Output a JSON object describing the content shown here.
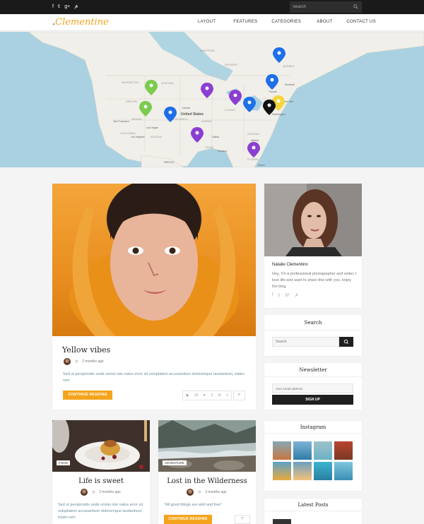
{
  "topbar": {
    "social_icons": [
      "facebook-icon",
      "twitter-icon",
      "google-plus-icon",
      "pinterest-icon"
    ],
    "social_glyphs": [
      "f",
      "𝕥",
      "g+",
      "𝓅"
    ],
    "search_placeholder": "Search"
  },
  "nav": {
    "logo": "Clementine",
    "logo_dot": ".",
    "items": [
      "LAYOUT",
      "FEATURES",
      "CATEGORIES",
      "ABOUT",
      "CONTACT US"
    ]
  },
  "map": {
    "labels": {
      "us": "United States",
      "mexico": "Mexico",
      "canada_region": "MANITOBA",
      "ontario": "ONTARIO",
      "washington": "WASHINGTON",
      "montana": "MONTANA",
      "oregon": "OREGON",
      "nevada": "NEVADA",
      "texas": "TEXAS",
      "ohio": "OHIO",
      "illinois": "ILLINOIS",
      "california": "CALIFORNIA",
      "florida": "FLORIDA",
      "arizona": "ARIZONA",
      "colorado": "COLORADO",
      "kansas": "KANSAS",
      "georgia": "GEORGIA",
      "chicago": "Chicago",
      "dallas": "Dallas",
      "las_vegas": "Las Vegas",
      "los_angeles": "Los Angeles",
      "san_francisco": "San Francisco",
      "houston": "Houston",
      "miami": "Miami",
      "denver": "Denver",
      "toronto": "Toronto",
      "montreal": "Montreal",
      "new_york": "New York",
      "washington_dc": "Washington",
      "atlanta": "Atlanta",
      "quebec": "QUEBEC"
    },
    "marker_colors": {
      "blue": "#1e6fe8",
      "purple": "#8b3fd1",
      "green": "#7ccb4f",
      "black": "#111111",
      "yellow": "#f5d63c"
    }
  },
  "featured": {
    "title": "Yellow vibes",
    "date": "2 months ago",
    "excerpt": "Sed ut perspiciatis unde omnis iste natus error sit voluptatem accusantium doloremque laudantium, totam rem",
    "button": "CONTINUE READING",
    "views": "15",
    "likes": "2",
    "comments": "1"
  },
  "posts": [
    {
      "tag": "FOOD",
      "title": "Life is sweet",
      "date": "2 months ago",
      "excerpt": "Sed ut perspiciatis unde omnis iste natus error sit voluptatem accusantium doloremque laudantium, totam rem"
    },
    {
      "tag": "ADVENTURE",
      "title": "Lost in the Wilderness",
      "date": "2 months ago",
      "excerpt": "\"All good things are wild and free\"",
      "button": "CONTINUE READING"
    }
  ],
  "sidebar": {
    "about": {
      "name": "Natalie Clementino",
      "bio": "Hey, I'm a professional photographer and writer, I love life and want to share this with you, enjoy the blog"
    },
    "search": {
      "title": "Search",
      "placeholder": "Search"
    },
    "newsletter": {
      "title": "Newsletter",
      "placeholder": "Your email address",
      "button": "SIGN UP"
    },
    "instagram": {
      "title": "Instagram"
    },
    "latest": {
      "title": "Latest Posts"
    }
  }
}
